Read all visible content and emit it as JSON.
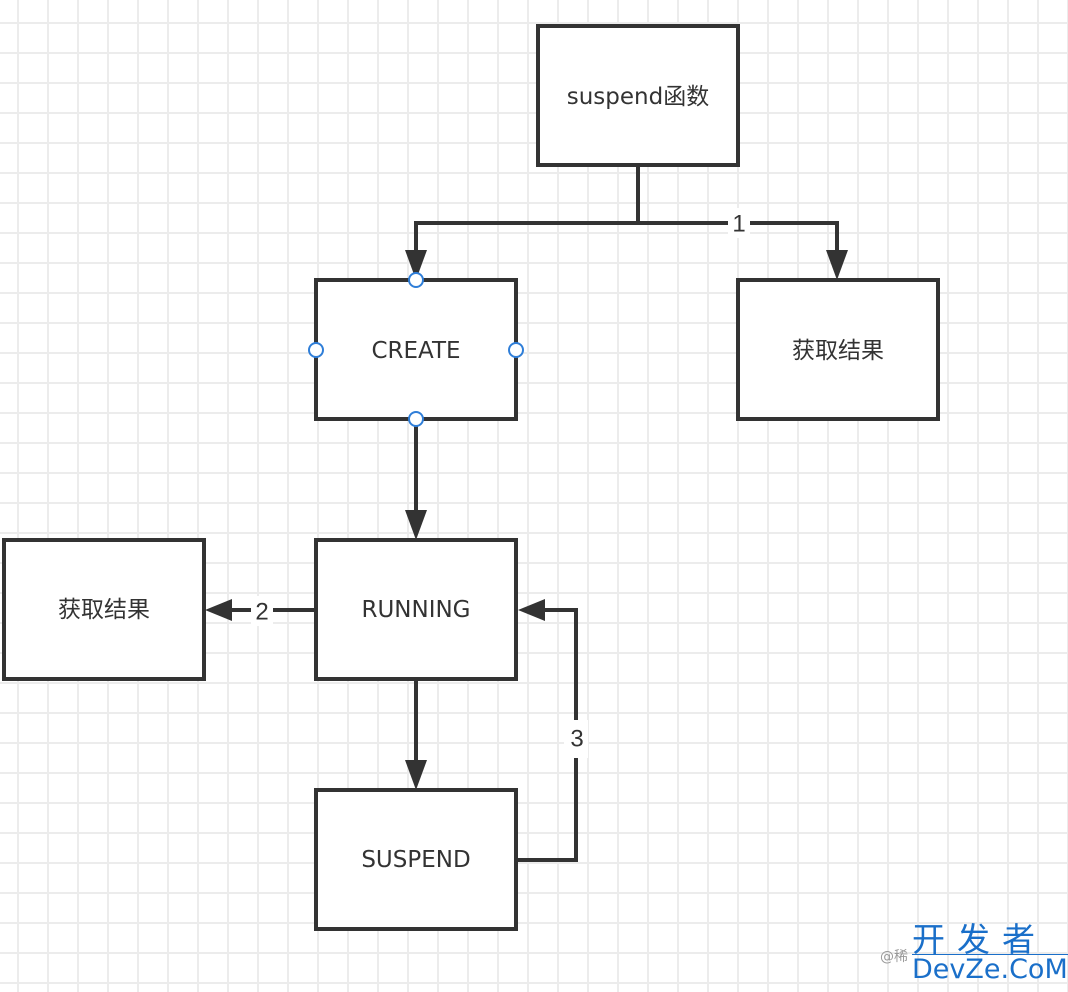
{
  "diagram": {
    "nodes": [
      {
        "id": "suspend-fn",
        "label": "suspend函数"
      },
      {
        "id": "create",
        "label": "CREATE"
      },
      {
        "id": "result-1",
        "label": "获取结果"
      },
      {
        "id": "running",
        "label": "RUNNING"
      },
      {
        "id": "result-2",
        "label": "获取结果"
      },
      {
        "id": "suspend",
        "label": "SUSPEND"
      }
    ],
    "edges": [
      {
        "from": "suspend-fn",
        "to": "create",
        "label": ""
      },
      {
        "from": "suspend-fn",
        "to": "result-1",
        "label": "1"
      },
      {
        "from": "create",
        "to": "running",
        "label": ""
      },
      {
        "from": "running",
        "to": "result-2",
        "label": "2"
      },
      {
        "from": "running",
        "to": "suspend",
        "label": ""
      },
      {
        "from": "suspend",
        "to": "running",
        "label": "3"
      }
    ],
    "selected_node": "create",
    "colors": {
      "stroke": "#333333",
      "handle": "#2f7ed8",
      "grid": "#ececec"
    }
  },
  "watermark": {
    "prefix": "@稀",
    "line1": "开发者",
    "line2": "DevZe.CoM"
  }
}
